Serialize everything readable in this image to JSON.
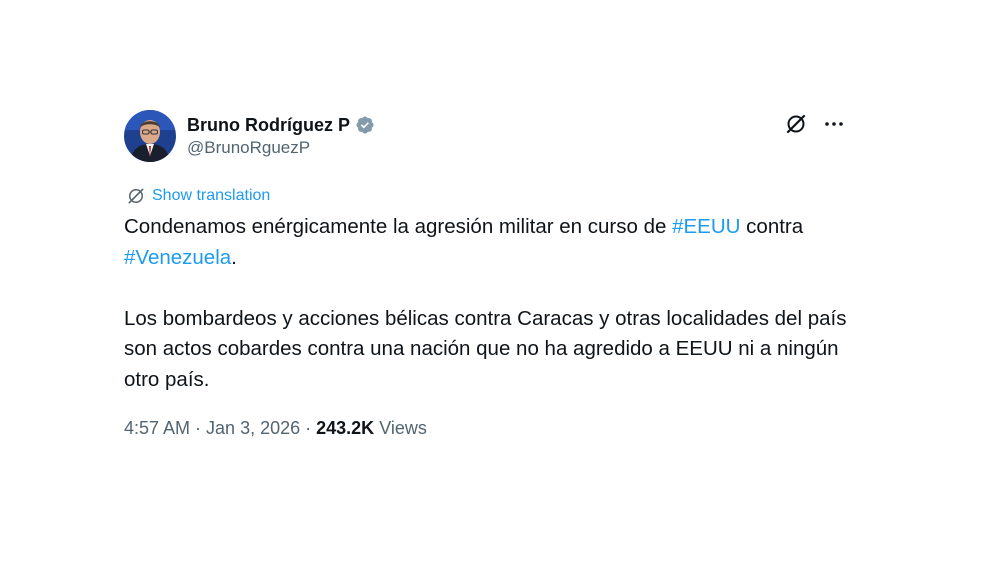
{
  "author": {
    "display_name": "Bruno Rodríguez P",
    "handle": "@BrunoRguezP",
    "verified": true,
    "verified_color": "#829aab"
  },
  "actions": {
    "grok_icon": "grok-icon",
    "more_icon": "more-icon"
  },
  "translation": {
    "label": "Show translation",
    "icon": "translate-icon"
  },
  "tweet": {
    "p1_before": "Condenamos enérgicamente la agresión militar en curso de ",
    "p1_hashtag1": "#EEUU",
    "p1_middle": " contra ",
    "p1_hashtag2": "#Venezuela",
    "p1_after": ".",
    "p2": "Los bombardeos y acciones bélicas contra Caracas y otras localidades del país son actos cobardes contra una nación que no ha agredido a EEUU ni a ningún otro país."
  },
  "meta": {
    "time": "4:57 AM",
    "separator": " · ",
    "date": "Jan 3, 2026",
    "views_count": "243.2K",
    "views_label": "Views"
  },
  "colors": {
    "link": "#1d9bf0",
    "text": "#0f1419",
    "secondary": "#536471"
  }
}
